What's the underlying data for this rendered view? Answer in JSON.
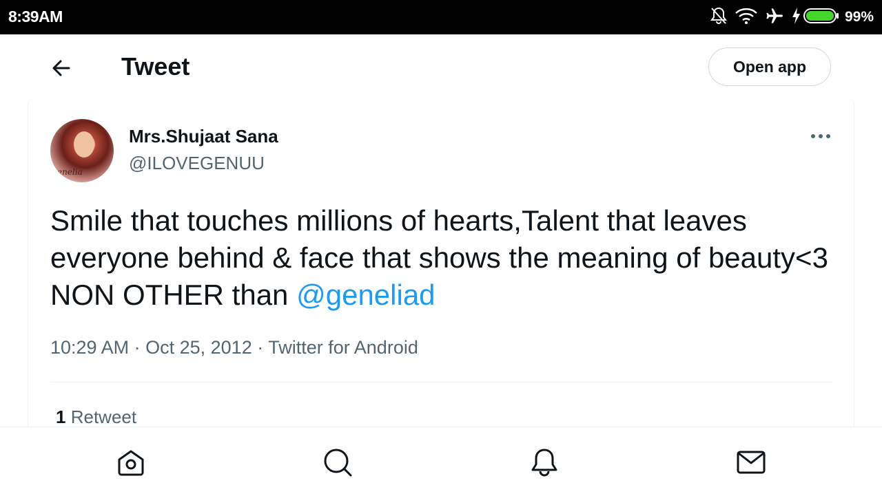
{
  "status_bar": {
    "time": "8:39AM",
    "battery_percent": "99%",
    "icons": [
      "notifications-off-icon",
      "wifi-icon",
      "airplane-mode-icon",
      "charging-icon",
      "battery-icon"
    ]
  },
  "header": {
    "back_icon": "arrow-left-icon",
    "title": "Tweet",
    "open_app_label": "Open app"
  },
  "tweet": {
    "author_name": "Mrs.Shujaat Sana",
    "author_handle": "@ILOVEGENUU",
    "avatar_caption": "enelia",
    "more_icon": "more-horizontal-icon",
    "text_plain": "Smile that touches millions of hearts,Talent that leaves everyone behind & face that shows the meaning of beauty<3 NON OTHER than ",
    "mention": "@geneliad",
    "time": "10:29 AM",
    "date": "Oct 25, 2012",
    "source": "Twitter for Android",
    "separator": "·",
    "retweet_count": "1",
    "retweet_label": "Retweet"
  },
  "bottom_nav": {
    "items": [
      "home-icon",
      "search-icon",
      "notifications-icon",
      "messages-icon"
    ]
  },
  "colors": {
    "accent": "#1d9bf0",
    "text_primary": "#0f1419",
    "text_secondary": "#536471",
    "border": "#cfd9de"
  }
}
